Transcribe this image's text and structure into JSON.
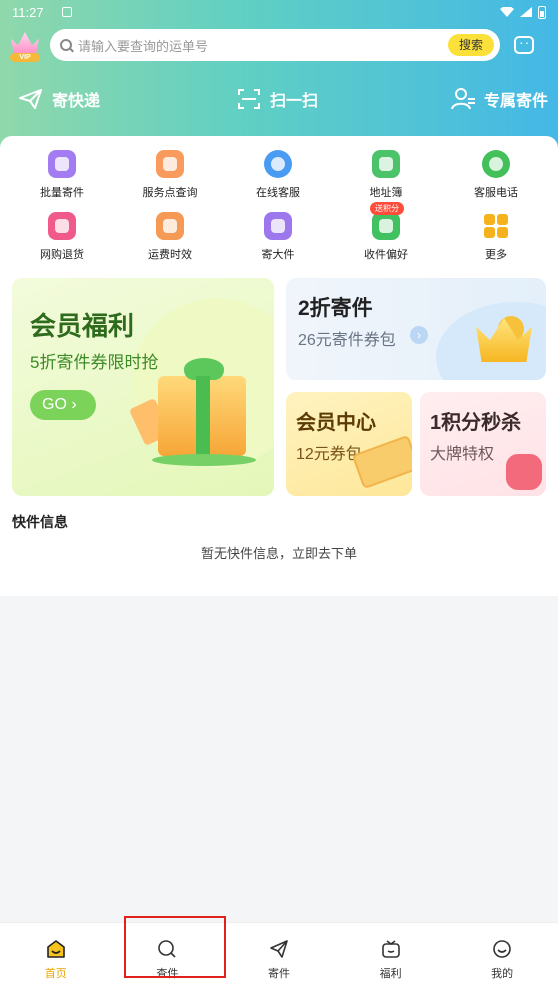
{
  "status_bar": {
    "time": "11:27"
  },
  "header": {
    "vip_label": "VIP",
    "search_placeholder": "请输入要查询的运单号",
    "search_button": "搜索"
  },
  "quick_actions": [
    {
      "label": "寄快递",
      "icon": "paper-plane-icon"
    },
    {
      "label": "扫一扫",
      "icon": "scan-icon"
    },
    {
      "label": "专属寄件",
      "icon": "user-icon"
    }
  ],
  "services": [
    {
      "label": "批量寄件",
      "icon": "batch-send-icon",
      "color": "#a27cf0"
    },
    {
      "label": "服务点查询",
      "icon": "service-point-icon",
      "color": "#f89b5c"
    },
    {
      "label": "在线客服",
      "icon": "chat-icon",
      "color": "#4a9cf2"
    },
    {
      "label": "地址簿",
      "icon": "address-book-icon",
      "color": "#4cc36a"
    },
    {
      "label": "客服电话",
      "icon": "phone-icon",
      "color": "#44c05a"
    },
    {
      "label": "网购退货",
      "icon": "return-icon",
      "color": "#f05a8a"
    },
    {
      "label": "运费时效",
      "icon": "freight-icon",
      "color": "#f59a55"
    },
    {
      "label": "寄大件",
      "icon": "large-package-icon",
      "color": "#9c78ec"
    },
    {
      "label": "收件偏好",
      "icon": "preference-icon",
      "color": "#42c162"
    },
    {
      "label": "更多",
      "icon": "more-icon",
      "color": "#f6b21c"
    }
  ],
  "preference_badge": "送积分",
  "promos": {
    "member_welfare": {
      "title": "会员福利",
      "subtitle": "5折寄件券限时抢",
      "button": "GO"
    },
    "discount_send": {
      "title": "2折寄件",
      "subtitle": "26元寄件券包"
    },
    "member_center": {
      "title": "会员中心",
      "subtitle": "12元券包"
    },
    "points_flash": {
      "title": "1积分秒杀",
      "subtitle": "大牌特权"
    }
  },
  "parcel_section": {
    "title": "快件信息",
    "empty_message": "暂无快件信息，立即去下单"
  },
  "bottom_nav": [
    {
      "label": "首页",
      "icon": "home-icon",
      "active": true
    },
    {
      "label": "查件",
      "icon": "search-parcel-icon",
      "active": false
    },
    {
      "label": "寄件",
      "icon": "send-icon",
      "active": false
    },
    {
      "label": "福利",
      "icon": "gift-icon",
      "active": false
    },
    {
      "label": "我的",
      "icon": "profile-icon",
      "active": false
    }
  ],
  "colors": {
    "accent_yellow": "#fbe03a",
    "active_nav": "#e8a600",
    "highlight_box": "#e0201a"
  }
}
